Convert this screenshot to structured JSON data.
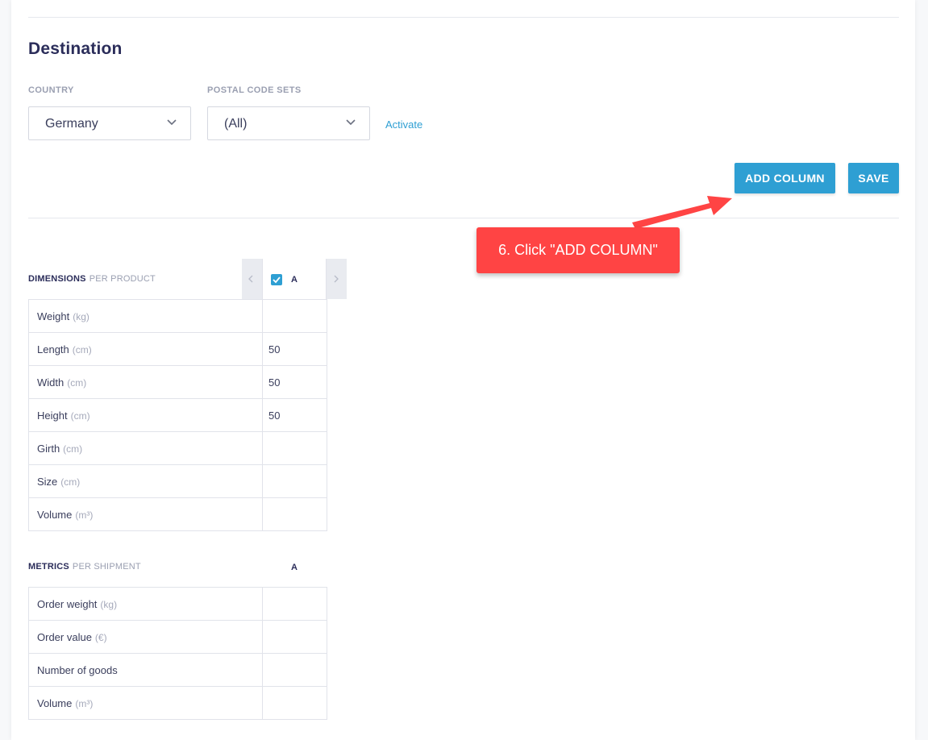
{
  "destination": {
    "title": "Destination",
    "country": {
      "label": "COUNTRY",
      "value": "Germany"
    },
    "postal_code_sets": {
      "label": "POSTAL CODE SETS",
      "value": "(All)"
    },
    "activate_link": "Activate"
  },
  "toolbar": {
    "add_column_label": "ADD COLUMN",
    "save_label": "SAVE"
  },
  "dimensions": {
    "title": "DIMENSIONS",
    "subtitle": "PER PRODUCT",
    "column": "A",
    "column_checked": true,
    "rows": [
      {
        "label": "Weight",
        "unit": "(kg)",
        "value": ""
      },
      {
        "label": "Length",
        "unit": "(cm)",
        "value": "50"
      },
      {
        "label": "Width",
        "unit": "(cm)",
        "value": "50"
      },
      {
        "label": "Height",
        "unit": "(cm)",
        "value": "50"
      },
      {
        "label": "Girth",
        "unit": "(cm)",
        "value": ""
      },
      {
        "label": "Size",
        "unit": "(cm)",
        "value": ""
      },
      {
        "label": "Volume",
        "unit": "(m³)",
        "value": ""
      }
    ]
  },
  "metrics": {
    "title": "METRICS",
    "subtitle": "PER SHIPMENT",
    "column": "A",
    "rows": [
      {
        "label": "Order weight",
        "unit": "(kg)",
        "value": ""
      },
      {
        "label": "Order value",
        "unit": "(€)",
        "value": ""
      },
      {
        "label": "Number of goods",
        "unit": "",
        "value": ""
      },
      {
        "label": "Volume",
        "unit": "(m³)",
        "value": ""
      }
    ]
  },
  "annotation": {
    "text": "6. Click \"ADD COLUMN\"",
    "color": "#ff4444"
  },
  "colors": {
    "accent": "#2e9fd3",
    "title": "#2b2d5a"
  },
  "icons": {
    "select_chevron": "chevron-down-icon",
    "column_prev": "chevron-left-icon",
    "column_next": "chevron-right-icon",
    "checkbox": "check-icon"
  }
}
